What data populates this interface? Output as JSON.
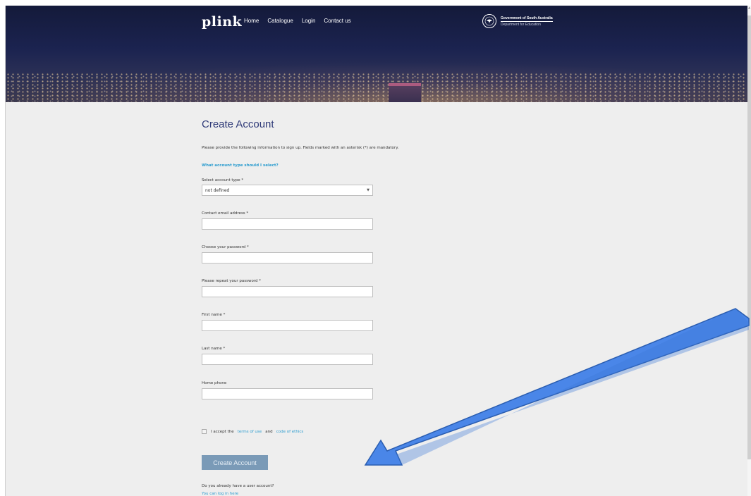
{
  "header": {
    "logo": "plink",
    "nav": [
      "Home",
      "Catalogue",
      "Login",
      "Contact us"
    ],
    "gov_line1": "Government of South Australia",
    "gov_line2": "Department for Education"
  },
  "form": {
    "title": "Create Account",
    "intro": "Please provide the following information to sign up. Fields marked with an asterisk (*) are mandatory.",
    "help_link": "What account type should I select?",
    "account_type_label": "Select account type *",
    "account_type_value": "not defined",
    "email_label": "Contact email address *",
    "password_label": "Choose your password *",
    "repeat_password_label": "Please repeat your password *",
    "first_name_label": "First name *",
    "last_name_label": "Last name *",
    "home_phone_label": "Home phone",
    "terms_prefix": "I accept the",
    "terms_of_use": "terms of use",
    "terms_and": "and",
    "code_of_ethics": "code of ethics",
    "submit_label": "Create Account",
    "already_text": "Do you already have a user account?",
    "login_link": "You can log in here"
  },
  "colors": {
    "header_bg": "#1b2350",
    "title": "#2f3a78",
    "link": "#2b9ccf",
    "button": "#7a9ab7",
    "arrow_fill": "#4a86e8"
  }
}
